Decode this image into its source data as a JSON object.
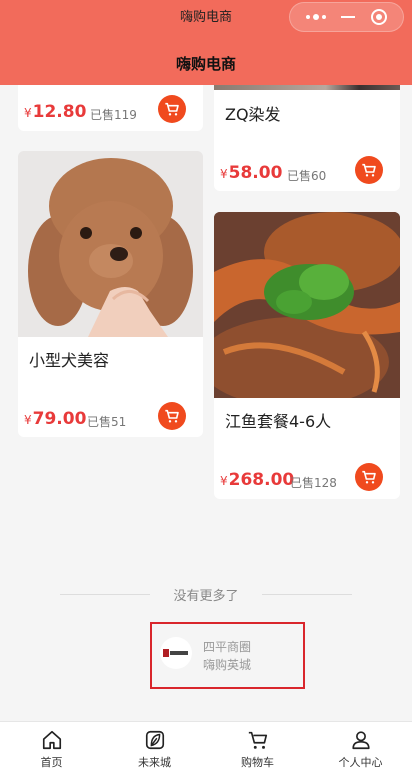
{
  "app": {
    "status_title": "嗨购电商",
    "nav_title": "嗨购电商",
    "theme_color": "#f26b5b",
    "price_color": "#e83a3a",
    "cart_color": "#f04a1e"
  },
  "products": [
    {
      "title": "",
      "currency": "¥",
      "price": "12.80",
      "sold": "已售119"
    },
    {
      "title": "ZQ染发",
      "currency": "¥",
      "price": "58.00",
      "sold": "已售60"
    },
    {
      "title": "小型犬美容",
      "currency": "¥",
      "price": "79.00",
      "sold": "已售51"
    },
    {
      "title": "江鱼套餐4-6人",
      "currency": "¥",
      "price": "268.00",
      "sold": "已售128"
    }
  ],
  "footer": {
    "no_more": "没有更多了",
    "shop_name": "四平商圈",
    "shop_sub": "嗨购英城"
  },
  "tabbar": [
    {
      "label": "首页",
      "icon": "home-icon"
    },
    {
      "label": "未来城",
      "icon": "leaf-icon"
    },
    {
      "label": "购物车",
      "icon": "cart-icon"
    },
    {
      "label": "个人中心",
      "icon": "user-icon"
    }
  ]
}
